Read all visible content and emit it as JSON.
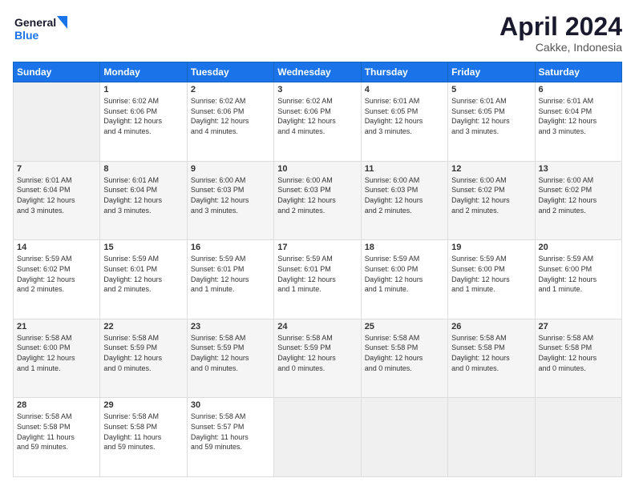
{
  "logo": {
    "line1": "General",
    "line2": "Blue"
  },
  "title": "April 2024",
  "location": "Cakke, Indonesia",
  "days_of_week": [
    "Sunday",
    "Monday",
    "Tuesday",
    "Wednesday",
    "Thursday",
    "Friday",
    "Saturday"
  ],
  "weeks": [
    [
      {
        "day": "",
        "info": ""
      },
      {
        "day": "1",
        "info": "Sunrise: 6:02 AM\nSunset: 6:06 PM\nDaylight: 12 hours\nand 4 minutes."
      },
      {
        "day": "2",
        "info": "Sunrise: 6:02 AM\nSunset: 6:06 PM\nDaylight: 12 hours\nand 4 minutes."
      },
      {
        "day": "3",
        "info": "Sunrise: 6:02 AM\nSunset: 6:06 PM\nDaylight: 12 hours\nand 4 minutes."
      },
      {
        "day": "4",
        "info": "Sunrise: 6:01 AM\nSunset: 6:05 PM\nDaylight: 12 hours\nand 3 minutes."
      },
      {
        "day": "5",
        "info": "Sunrise: 6:01 AM\nSunset: 6:05 PM\nDaylight: 12 hours\nand 3 minutes."
      },
      {
        "day": "6",
        "info": "Sunrise: 6:01 AM\nSunset: 6:04 PM\nDaylight: 12 hours\nand 3 minutes."
      }
    ],
    [
      {
        "day": "7",
        "info": "Sunrise: 6:01 AM\nSunset: 6:04 PM\nDaylight: 12 hours\nand 3 minutes."
      },
      {
        "day": "8",
        "info": "Sunrise: 6:01 AM\nSunset: 6:04 PM\nDaylight: 12 hours\nand 3 minutes."
      },
      {
        "day": "9",
        "info": "Sunrise: 6:00 AM\nSunset: 6:03 PM\nDaylight: 12 hours\nand 3 minutes."
      },
      {
        "day": "10",
        "info": "Sunrise: 6:00 AM\nSunset: 6:03 PM\nDaylight: 12 hours\nand 2 minutes."
      },
      {
        "day": "11",
        "info": "Sunrise: 6:00 AM\nSunset: 6:03 PM\nDaylight: 12 hours\nand 2 minutes."
      },
      {
        "day": "12",
        "info": "Sunrise: 6:00 AM\nSunset: 6:02 PM\nDaylight: 12 hours\nand 2 minutes."
      },
      {
        "day": "13",
        "info": "Sunrise: 6:00 AM\nSunset: 6:02 PM\nDaylight: 12 hours\nand 2 minutes."
      }
    ],
    [
      {
        "day": "14",
        "info": "Sunrise: 5:59 AM\nSunset: 6:02 PM\nDaylight: 12 hours\nand 2 minutes."
      },
      {
        "day": "15",
        "info": "Sunrise: 5:59 AM\nSunset: 6:01 PM\nDaylight: 12 hours\nand 2 minutes."
      },
      {
        "day": "16",
        "info": "Sunrise: 5:59 AM\nSunset: 6:01 PM\nDaylight: 12 hours\nand 1 minute."
      },
      {
        "day": "17",
        "info": "Sunrise: 5:59 AM\nSunset: 6:01 PM\nDaylight: 12 hours\nand 1 minute."
      },
      {
        "day": "18",
        "info": "Sunrise: 5:59 AM\nSunset: 6:00 PM\nDaylight: 12 hours\nand 1 minute."
      },
      {
        "day": "19",
        "info": "Sunrise: 5:59 AM\nSunset: 6:00 PM\nDaylight: 12 hours\nand 1 minute."
      },
      {
        "day": "20",
        "info": "Sunrise: 5:59 AM\nSunset: 6:00 PM\nDaylight: 12 hours\nand 1 minute."
      }
    ],
    [
      {
        "day": "21",
        "info": "Sunrise: 5:58 AM\nSunset: 6:00 PM\nDaylight: 12 hours\nand 1 minute."
      },
      {
        "day": "22",
        "info": "Sunrise: 5:58 AM\nSunset: 5:59 PM\nDaylight: 12 hours\nand 0 minutes."
      },
      {
        "day": "23",
        "info": "Sunrise: 5:58 AM\nSunset: 5:59 PM\nDaylight: 12 hours\nand 0 minutes."
      },
      {
        "day": "24",
        "info": "Sunrise: 5:58 AM\nSunset: 5:59 PM\nDaylight: 12 hours\nand 0 minutes."
      },
      {
        "day": "25",
        "info": "Sunrise: 5:58 AM\nSunset: 5:58 PM\nDaylight: 12 hours\nand 0 minutes."
      },
      {
        "day": "26",
        "info": "Sunrise: 5:58 AM\nSunset: 5:58 PM\nDaylight: 12 hours\nand 0 minutes."
      },
      {
        "day": "27",
        "info": "Sunrise: 5:58 AM\nSunset: 5:58 PM\nDaylight: 12 hours\nand 0 minutes."
      }
    ],
    [
      {
        "day": "28",
        "info": "Sunrise: 5:58 AM\nSunset: 5:58 PM\nDaylight: 11 hours\nand 59 minutes."
      },
      {
        "day": "29",
        "info": "Sunrise: 5:58 AM\nSunset: 5:58 PM\nDaylight: 11 hours\nand 59 minutes."
      },
      {
        "day": "30",
        "info": "Sunrise: 5:58 AM\nSunset: 5:57 PM\nDaylight: 11 hours\nand 59 minutes."
      },
      {
        "day": "",
        "info": ""
      },
      {
        "day": "",
        "info": ""
      },
      {
        "day": "",
        "info": ""
      },
      {
        "day": "",
        "info": ""
      }
    ]
  ]
}
